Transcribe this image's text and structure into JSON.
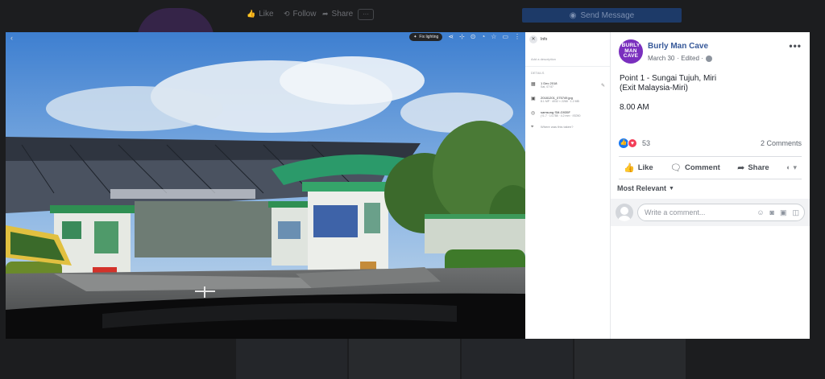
{
  "background_page": {
    "like_label": "Like",
    "follow_label": "Follow",
    "share_label": "Share",
    "more_label": "···",
    "send_message_label": "Send Message"
  },
  "photo": {
    "toolbar_back": "‹",
    "chip_label": "Fix lighting",
    "icons": [
      "share-icon",
      "tag-icon",
      "location-icon",
      "timer-icon",
      "star-icon",
      "delete-icon",
      "more-icon"
    ]
  },
  "info_panel": {
    "title": "Info",
    "description_placeholder": "Add a description",
    "details_heading": "DETAILS",
    "date": "1 Dec 2018",
    "date_sub": "Sat, 07:57",
    "file_name": "20181201_075749.jpg",
    "file_sub": "8.1 MP · 4032 × 2268 · 1.2 MB",
    "camera": "samsung SM-G935F",
    "camera_sub": "ƒ/1.7 · 1/1788 · 4.2 mm · ISO50",
    "location_prompt": "Where was this taken?"
  },
  "post": {
    "avatar_lines": [
      "BURLY",
      "MAN",
      "CAVE"
    ],
    "page_name": "Burly Man Cave",
    "date": "March 30",
    "edited": "· Edited ·",
    "line1": "Point 1 - Sungai Tujuh, Miri",
    "line2": "(Exit Malaysia-Miri)",
    "line3": "8.00 AM",
    "reaction_count": "53",
    "comments_count": "2 Comments",
    "like_label": "Like",
    "comment_label": "Comment",
    "share_label": "Share",
    "relevance_label": "Most Relevant",
    "comment_placeholder": "Write a comment..."
  }
}
